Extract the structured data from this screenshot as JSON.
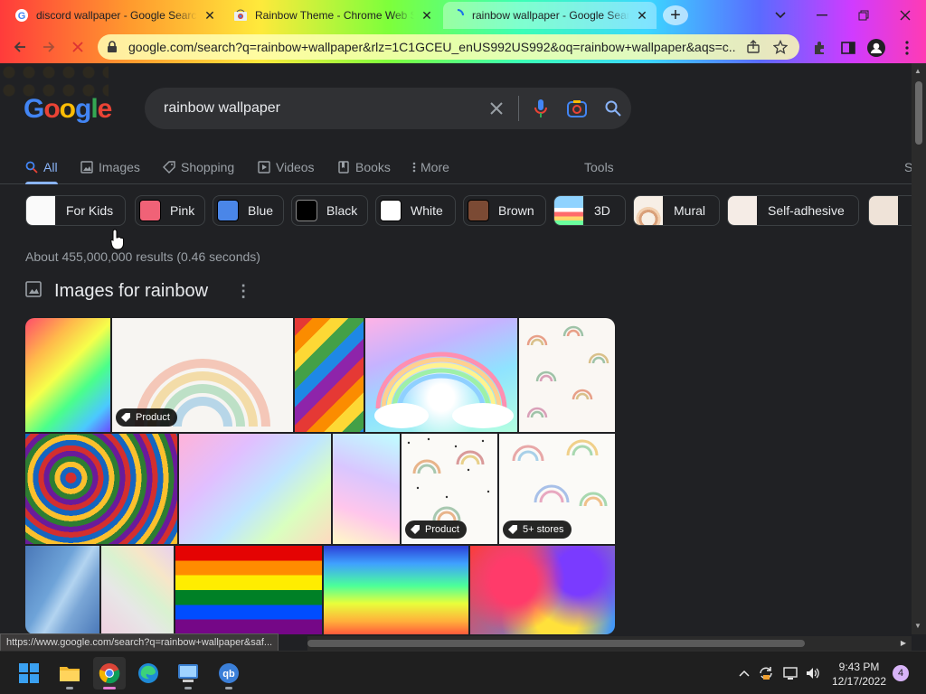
{
  "browser": {
    "tabs": [
      {
        "title": "discord wallpaper - Google Search",
        "favicon": "google-icon",
        "active": false
      },
      {
        "title": "Rainbow Theme - Chrome Web Store",
        "favicon": "chrome-web-store-icon",
        "active": false
      },
      {
        "title": "rainbow wallpaper - Google Search",
        "favicon": "loading-spinner-icon",
        "active": true
      }
    ],
    "new_tab_label": "+",
    "address": "google.com/search?q=rainbow+wallpaper&rlz=1C1GCEU_enUS992US992&oq=rainbow+wallpaper&aqs=c..."
  },
  "google": {
    "logo_letters": [
      "G",
      "o",
      "o",
      "g",
      "l",
      "e"
    ],
    "logo_colors": [
      "#4285f4",
      "#ea4335",
      "#fbbc05",
      "#4285f4",
      "#34a853",
      "#ea4335"
    ],
    "query": "rainbow wallpaper",
    "nav_tabs": [
      {
        "label": "All",
        "icon": "search-icon",
        "active": true
      },
      {
        "label": "Images",
        "icon": "image-icon",
        "active": false
      },
      {
        "label": "Shopping",
        "icon": "tag-icon",
        "active": false
      },
      {
        "label": "Videos",
        "icon": "play-icon",
        "active": false
      },
      {
        "label": "Books",
        "icon": "book-icon",
        "active": false
      },
      {
        "label": "More",
        "icon": "more-vert-icon",
        "active": false
      }
    ],
    "tools_label": "Tools",
    "cut_label": "S",
    "chips": [
      {
        "label": "For Kids"
      },
      {
        "label": "Pink",
        "color": "#f06277"
      },
      {
        "label": "Blue",
        "color": "#4a86e8"
      },
      {
        "label": "Black",
        "color": "#000000"
      },
      {
        "label": "White",
        "color": "#ffffff"
      },
      {
        "label": "Brown",
        "color": "#7b4a34"
      },
      {
        "label": "3D"
      },
      {
        "label": "Mural"
      },
      {
        "label": "Self-adhesive"
      }
    ],
    "result_stats": "About 455,000,000 results (0.46 seconds)",
    "images_header": "Images for rainbow",
    "badges": {
      "product": "Product",
      "stores": "5+ stores"
    }
  },
  "status_url": "https://www.google.com/search?q=rainbow+wallpaper&saf...",
  "taskbar": {
    "time": "9:43 PM",
    "date": "12/17/2022",
    "notifications": "4"
  }
}
